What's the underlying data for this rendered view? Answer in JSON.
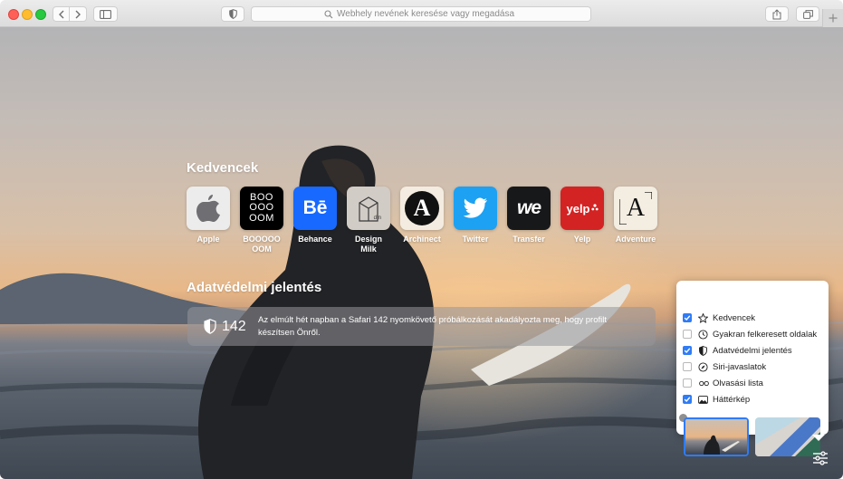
{
  "toolbar": {
    "address_placeholder": "Webhely nevének keresése vagy megadása",
    "icons": [
      "chevron-left-icon",
      "chevron-right-icon",
      "sidebar-icon",
      "shield-icon",
      "search-icon",
      "share-icon",
      "tabs-icon",
      "plus-icon"
    ]
  },
  "favorites": {
    "title": "Kedvencek",
    "items": [
      {
        "label": "Apple",
        "icon": "apple-icon"
      },
      {
        "label": "BOOOOO OOM",
        "icon": "booooooom-icon"
      },
      {
        "label": "Behance",
        "icon": "behance-icon"
      },
      {
        "label": "Design Milk",
        "icon": "design-milk-icon"
      },
      {
        "label": "Archinect",
        "icon": "archinect-icon"
      },
      {
        "label": "Twitter",
        "icon": "twitter-icon"
      },
      {
        "label": "Transfer",
        "icon": "wetransfer-icon"
      },
      {
        "label": "Yelp",
        "icon": "yelp-icon"
      },
      {
        "label": "Adventure",
        "icon": "adventure-icon"
      }
    ],
    "tile_text": {
      "booooooom_lines": [
        "BOO",
        "OOO",
        "OOM"
      ],
      "behance": "Bē",
      "design_milk": "dm",
      "archinect": "A",
      "wetransfer": "we",
      "yelp": "yelp",
      "adventure": "A"
    }
  },
  "privacy": {
    "title": "Adatvédelmi jelentés",
    "count": "142",
    "text": "Az elmúlt hét napban a Safari 142 nyomkövető próbálkozását akadályozta meg, hogy profilt készítsen Önről."
  },
  "customize": {
    "options": [
      {
        "label": "Kedvencek",
        "checked": true,
        "icon": "star-icon"
      },
      {
        "label": "Gyakran felkeresett oldalak",
        "checked": false,
        "icon": "clock-icon"
      },
      {
        "label": "Adatvédelmi jelentés",
        "checked": true,
        "icon": "shield-icon"
      },
      {
        "label": "Siri-javaslatok",
        "checked": false,
        "icon": "compass-icon"
      },
      {
        "label": "Olvasási lista",
        "checked": false,
        "icon": "glasses-icon"
      },
      {
        "label": "Háttérkép",
        "checked": true,
        "icon": "image-icon"
      }
    ],
    "selected_background": 0
  },
  "colors": {
    "accent": "#2f7cf6",
    "behance": "#1769ff",
    "twitter": "#1da1f2",
    "yelp": "#d32323"
  }
}
